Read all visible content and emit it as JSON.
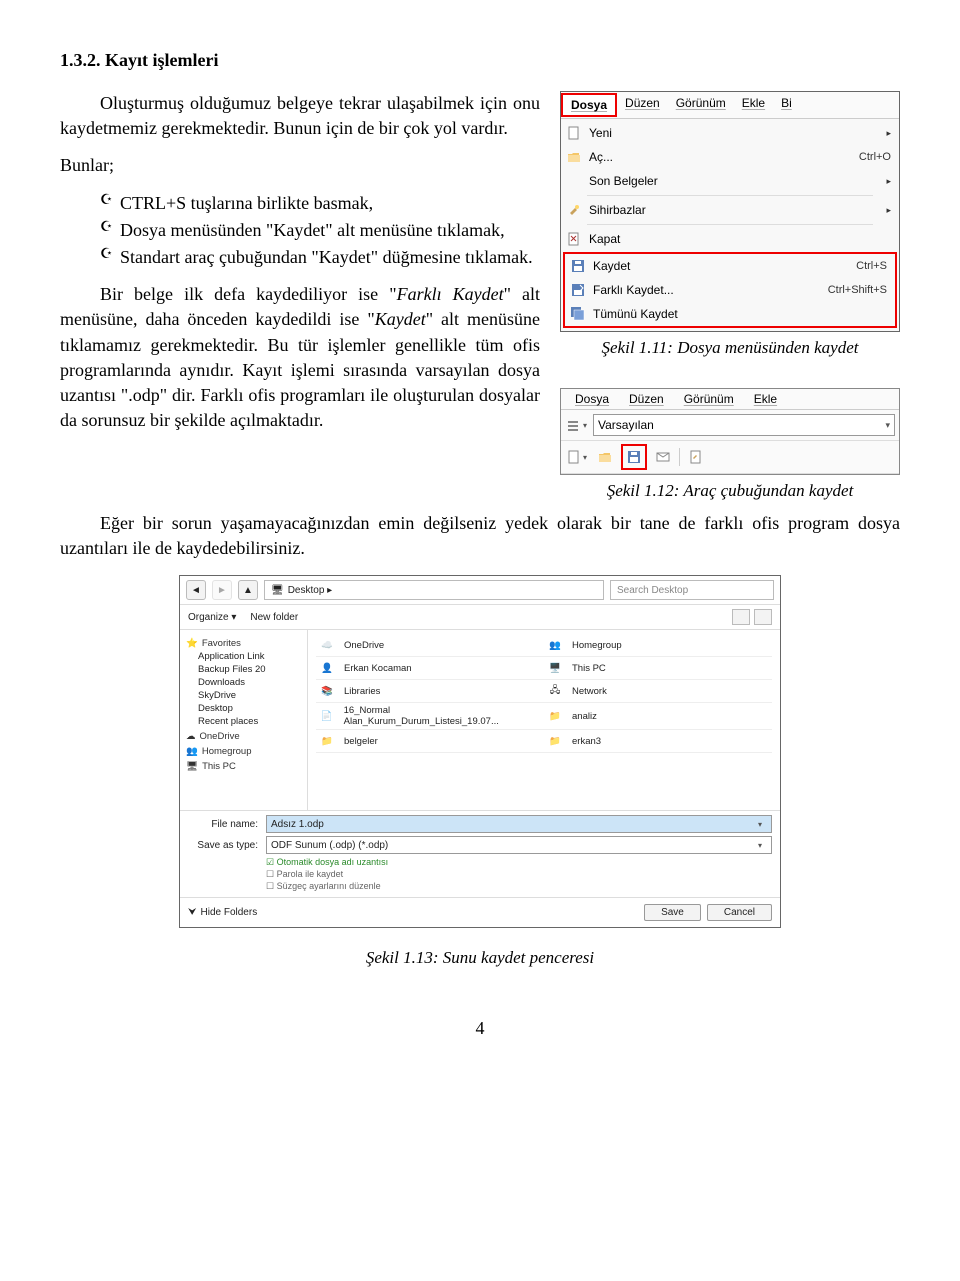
{
  "section": {
    "title": "1.3.2. Kayıt işlemleri"
  },
  "para1": "Oluşturmuş olduğumuz belgeye tekrar ulaşabilmek için onu kaydetmemiz gerekmektedir. Bunun için de bir çok yol vardır.",
  "bunlar": "Bunlar;",
  "bullets": [
    "CTRL+S tuşlarına birlikte basmak,",
    "Dosya menüsünden \"Kaydet\" alt menüsüne tıklamak,",
    "Standart araç çubuğundan \"Kaydet\" düğmesine tıklamak."
  ],
  "para2a": "Bir belge ilk defa kaydediliyor ise \"",
  "para2b": "Farklı Kaydet",
  "para2c": "\" alt menüsüne, daha önceden kaydedildi ise \"",
  "para2d": "Kaydet",
  "para2e": "\" alt menüsüne tıklamamız gerekmektedir. Bu tür işlemler genellikle tüm ofis programlarında aynıdır. Kayıt işlemi sırasında varsayılan dosya uzantısı \".odp\" dir. Farklı ofis programları ile oluşturulan dosyalar da sorunsuz bir şekilde açılmaktadır.",
  "caption1": "Şekil 1.11: Dosya menüsünden kaydet",
  "caption2": "Şekil 1.12: Araç çubuğundan kaydet",
  "para3": "Eğer bir sorun yaşamayacağınızdan emin değilseniz yedek olarak bir tane de farklı ofis program dosya uzantıları ile de kaydedebilirsiniz.",
  "caption3": "Şekil 1.13: Sunu kaydet penceresi",
  "pagenum": "4",
  "menu": {
    "bar": [
      "Dosya",
      "Düzen",
      "Görünüm",
      "Ekle",
      "Bi"
    ],
    "items": [
      {
        "label": "Yeni",
        "shortcut": "",
        "arrow": "▸",
        "icon": "new"
      },
      {
        "label": "Aç...",
        "shortcut": "Ctrl+O",
        "arrow": "",
        "icon": "open"
      },
      {
        "label": "Son Belgeler",
        "shortcut": "",
        "arrow": "▸",
        "icon": ""
      },
      {
        "label": "Sihirbazlar",
        "shortcut": "",
        "arrow": "▸",
        "icon": "wizard"
      },
      {
        "label": "Kapat",
        "shortcut": "",
        "arrow": "",
        "icon": "close",
        "sepBefore": true
      },
      {
        "label": "Kaydet",
        "shortcut": "Ctrl+S",
        "arrow": "",
        "icon": "save",
        "highlight": true
      },
      {
        "label": "Farklı Kaydet...",
        "shortcut": "Ctrl+Shift+S",
        "arrow": "",
        "icon": "saveas",
        "highlight": true
      },
      {
        "label": "Tümünü Kaydet",
        "shortcut": "",
        "arrow": "",
        "icon": "saveall",
        "highlight": true
      }
    ]
  },
  "toolbar": {
    "bar": [
      "Dosya",
      "Düzen",
      "Görünüm",
      "Ekle"
    ],
    "select": "Varsayılan"
  },
  "dialog": {
    "breadcrumb": "Desktop  ▸",
    "searchPlaceholder": "Search Desktop",
    "organize": "Organize ▾",
    "newfolder": "New folder",
    "sidebar": {
      "favs": "Favorites",
      "favItems": [
        "Application Link",
        "Backup Files 20",
        "Downloads",
        "SkyDrive",
        "Desktop",
        "Recent places"
      ],
      "onedrive": "OneDrive",
      "homegroup": "Homegroup",
      "thispc": "This PC"
    },
    "files": [
      [
        "OneDrive",
        "Homegroup"
      ],
      [
        "Erkan Kocaman",
        "This PC"
      ],
      [
        "Libraries",
        "Network"
      ],
      [
        "16_Normal Alan_Kurum_Durum_Listesi_19.07...",
        "analiz"
      ],
      [
        "belgeler",
        "erkan3"
      ]
    ],
    "fileNameLabel": "File name:",
    "fileName": "Adsız 1.odp",
    "saveTypeLabel": "Save as type:",
    "saveType": "ODF Sunum (.odp) (*.odp)",
    "checks": [
      "Otomatik dosya adı uzantısı",
      "Parola ile kaydet",
      "Süzgeç ayarlarını düzenle"
    ],
    "hideFolders": "Hide Folders",
    "save": "Save",
    "cancel": "Cancel"
  }
}
